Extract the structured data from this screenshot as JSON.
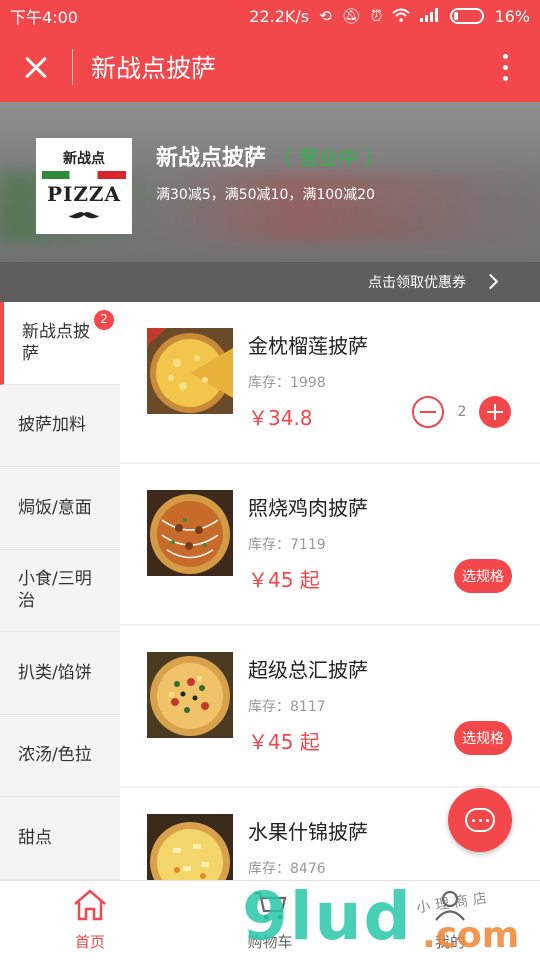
{
  "status_bar": {
    "time": "下午4:00",
    "net_speed": "22.2K/s",
    "battery_percent": "16%",
    "battery_level": 0.16,
    "icons": [
      "sync-icon",
      "mute-icon",
      "alarm-icon",
      "wifi-icon",
      "signal-icon",
      "battery-icon"
    ]
  },
  "titlebar": {
    "title": "新战点披萨",
    "close_icon": "close-icon",
    "more_icon": "more-vertical-icon"
  },
  "store": {
    "logo": {
      "text_cn": "新战点",
      "text_en": "PIZZA"
    },
    "name": "新战点披萨",
    "status": "（ 营业中 ）",
    "promo": "满30减5，满50减10，满100减20",
    "coupon_label": "点击领取优惠券"
  },
  "categories": [
    {
      "label": "新战点披萨",
      "badge": "2",
      "active": true
    },
    {
      "label": "披萨加料"
    },
    {
      "label": "焗饭/意面"
    },
    {
      "label": "小食/三明治"
    },
    {
      "label": "扒类/馅饼"
    },
    {
      "label": "浓汤/色拉"
    },
    {
      "label": "甜点"
    }
  ],
  "products": [
    {
      "name": "金枕榴莲披萨",
      "stock": "库存：1998",
      "price": "￥34.8",
      "quantity": "2"
    },
    {
      "name": "照烧鸡肉披萨",
      "stock": "库存：7119",
      "price": "￥45 起",
      "button": "选规格"
    },
    {
      "name": "超级总汇披萨",
      "stock": "库存：8117",
      "price": "￥45 起",
      "button": "选规格"
    },
    {
      "name": "水果什锦披萨",
      "stock": "库存：8476",
      "price": ""
    }
  ],
  "tabs": [
    {
      "label": "首页",
      "icon": "home-icon",
      "active": true
    },
    {
      "label": "购物车",
      "icon": "cart-icon"
    },
    {
      "label": "我的",
      "icon": "user-icon"
    }
  ],
  "colors": {
    "brand": "#f2484b",
    "status_green": "#2fb44a"
  },
  "watermark": {
    "main": "9lud",
    "domain": ".com",
    "small": "小理商店"
  }
}
